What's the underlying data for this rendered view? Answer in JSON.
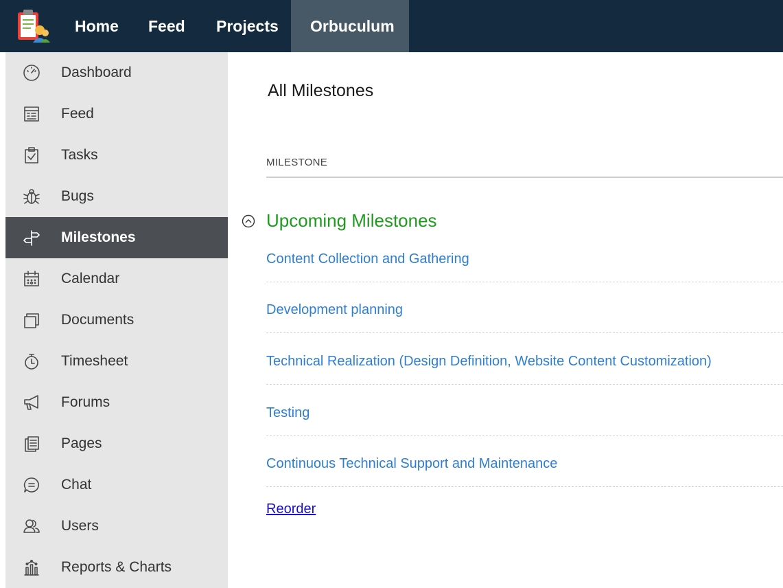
{
  "topnav": {
    "items": [
      {
        "label": "Home"
      },
      {
        "label": "Feed"
      },
      {
        "label": "Projects"
      },
      {
        "label": "Orbuculum"
      }
    ]
  },
  "sidebar": {
    "items": [
      {
        "label": "Dashboard",
        "icon": "dashboard-icon"
      },
      {
        "label": "Feed",
        "icon": "feed-icon"
      },
      {
        "label": "Tasks",
        "icon": "tasks-icon"
      },
      {
        "label": "Bugs",
        "icon": "bug-icon"
      },
      {
        "label": "Milestones",
        "icon": "signpost-icon"
      },
      {
        "label": "Calendar",
        "icon": "calendar-icon"
      },
      {
        "label": "Documents",
        "icon": "documents-icon"
      },
      {
        "label": "Timesheet",
        "icon": "timer-icon"
      },
      {
        "label": "Forums",
        "icon": "megaphone-icon"
      },
      {
        "label": "Pages",
        "icon": "pages-icon"
      },
      {
        "label": "Chat",
        "icon": "chat-icon"
      },
      {
        "label": "Users",
        "icon": "users-icon"
      },
      {
        "label": "Reports & Charts",
        "icon": "reports-icon"
      }
    ],
    "active": "Milestones"
  },
  "main": {
    "title": "All Milestones",
    "column_header": "MILESTONE",
    "group": {
      "title": "Upcoming Milestones",
      "milestones": [
        {
          "name": "Content Collection and Gathering"
        },
        {
          "name": "Development planning"
        },
        {
          "name": "Technical Realization (Design Definition, Website Content Customization)"
        },
        {
          "name": "Testing"
        },
        {
          "name": "Continuous Technical Support and Maintenance"
        }
      ]
    },
    "reorder_label": "Reorder"
  },
  "colors": {
    "topbar": "#142a3e",
    "topnav_active": "#475867",
    "sidebar_bg": "#e6e6e6",
    "sidebar_active": "#4b4e52",
    "group_title": "#1f9a1f",
    "link": "#2f7fd1"
  }
}
